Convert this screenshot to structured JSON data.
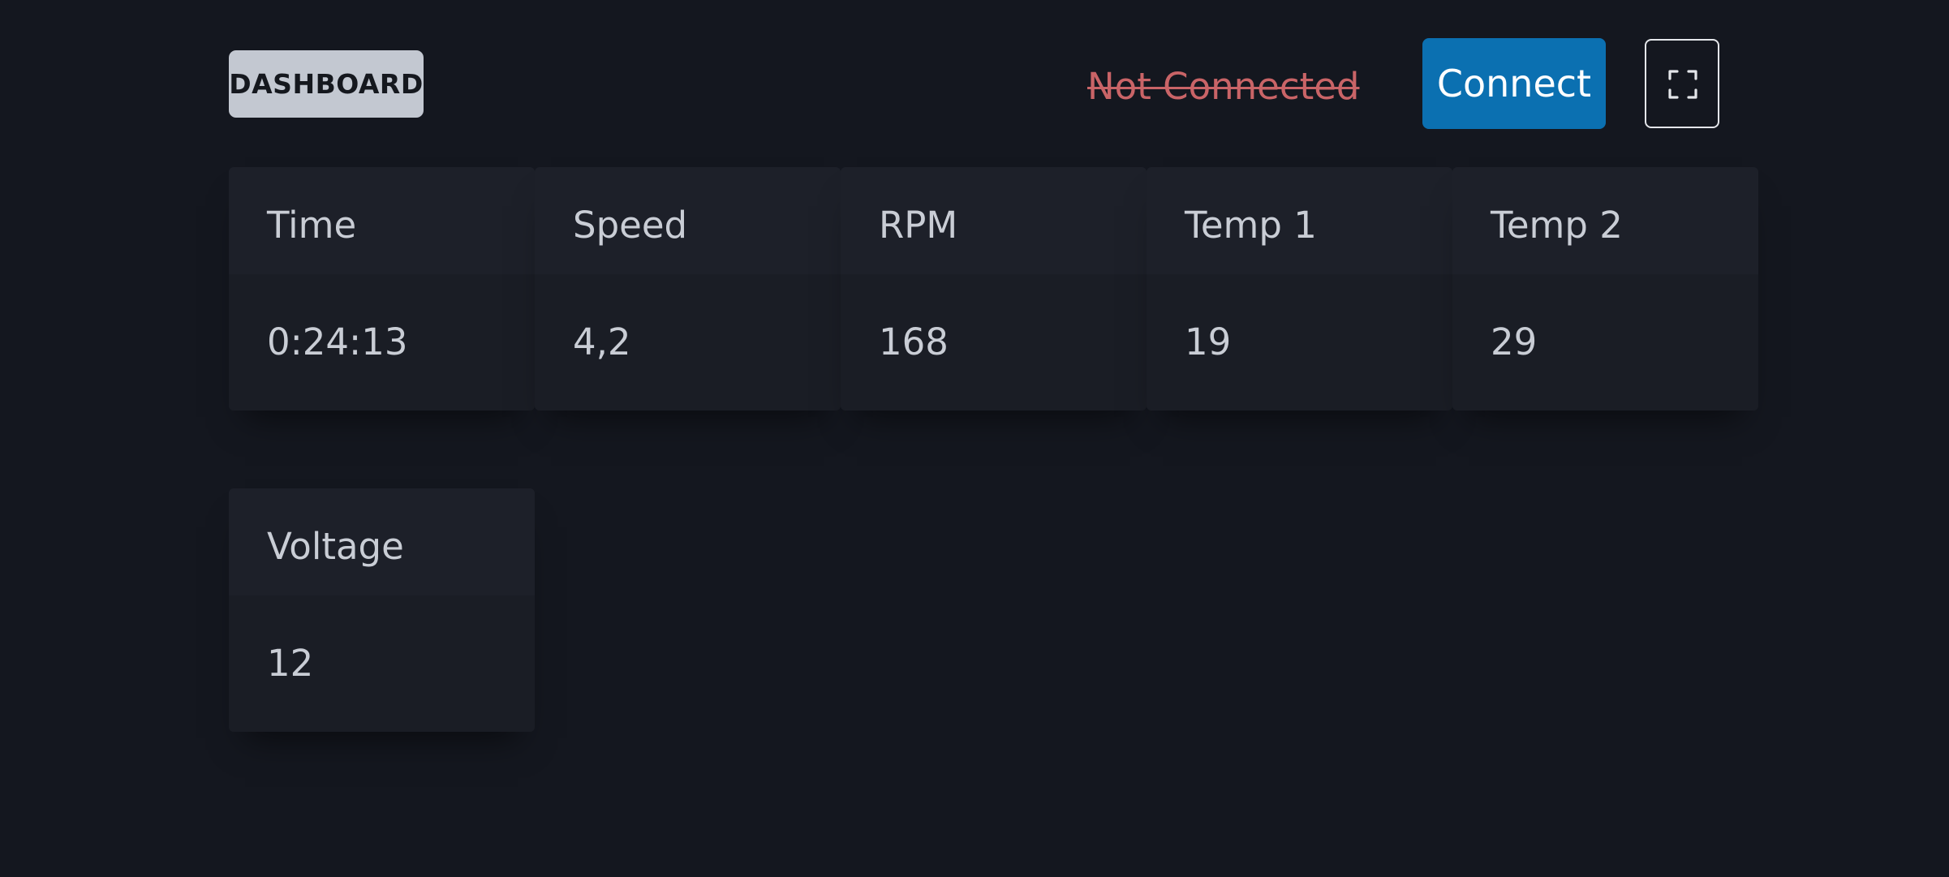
{
  "header": {
    "badge": "DASHBOARD",
    "status": "Not Connected",
    "connect_label": "Connect",
    "fullscreen_icon": "fullscreen-icon"
  },
  "colors": {
    "background": "#14171f",
    "card": "#1b1e26",
    "badge_bg": "#c3c8d1",
    "status_text": "#c96467",
    "connect_bg": "#0b70b1"
  },
  "metrics": [
    {
      "label": "Time",
      "value": "0:24:13"
    },
    {
      "label": "Speed",
      "value": "4,2"
    },
    {
      "label": "RPM",
      "value": "168"
    },
    {
      "label": "Temp 1",
      "value": "19"
    },
    {
      "label": "Temp 2",
      "value": "29"
    },
    {
      "label": "Voltage",
      "value": "12"
    }
  ]
}
